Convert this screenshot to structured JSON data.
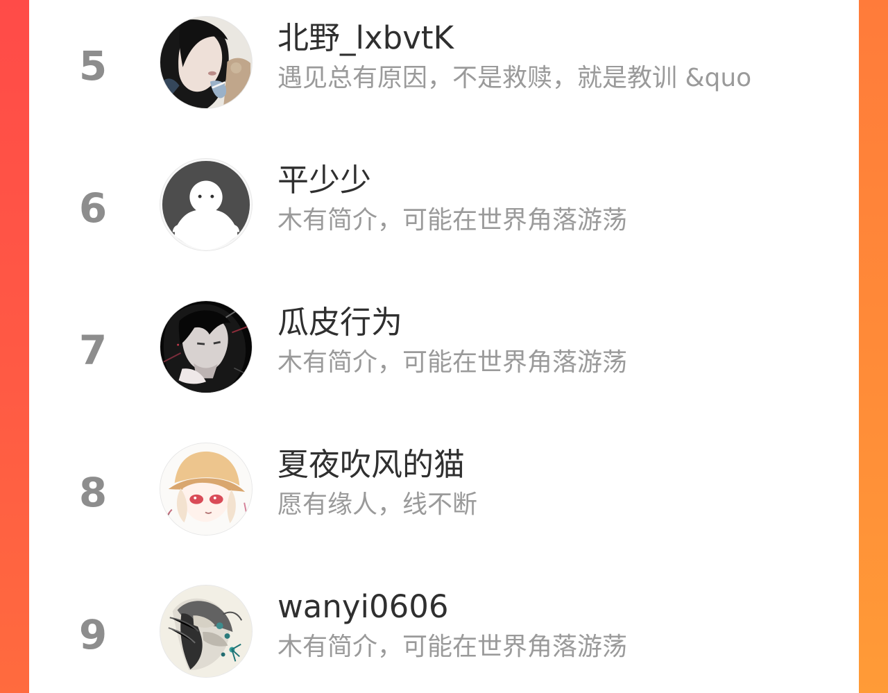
{
  "accent_colors": {
    "left_edge": "#ff4b48",
    "right_edge": "#ff8a3a",
    "rank_number": "#8d8d8d",
    "name_text": "#2f2f2f",
    "bio_text": "#9a9a9a"
  },
  "ranking_list": {
    "items": [
      {
        "rank": "5",
        "name": "北野_lxbvtK",
        "bio": "遇见总有原因，不是救赎，就是教训 &quo",
        "avatar_icon": "dark-haired-girl-avatar-icon"
      },
      {
        "rank": "6",
        "name": "平少少",
        "bio": "木有简介，可能在世界角落游荡",
        "avatar_icon": "default-white-person-avatar-icon"
      },
      {
        "rank": "7",
        "name": "瓜皮行为",
        "bio": "木有简介，可能在世界角落游荡",
        "avatar_icon": "hooded-anime-boy-avatar-icon"
      },
      {
        "rank": "8",
        "name": "夏夜吹风的猫",
        "bio": "愿有缘人，线不断",
        "avatar_icon": "anime-girl-yellow-hat-avatar-icon"
      },
      {
        "rank": "9",
        "name": "wanyi0606",
        "bio": "木有简介，可能在世界角落游荡",
        "avatar_icon": "sketch-profile-flowers-avatar-icon"
      }
    ]
  }
}
